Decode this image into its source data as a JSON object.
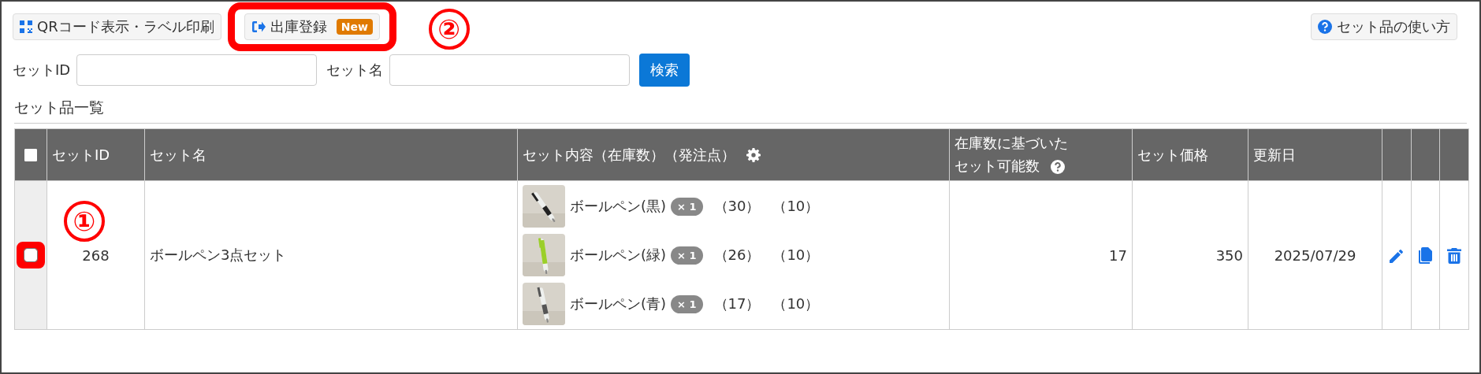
{
  "toolbar": {
    "buttons": [
      {
        "kind": "qr",
        "label": "QRコード表示・ラベル印刷",
        "highlighted": false
      },
      {
        "kind": "ship",
        "label": "出庫登録",
        "badge": "New",
        "highlighted": true,
        "callout": "②"
      }
    ],
    "help_button": {
      "label": "セット品の使い方"
    }
  },
  "search": {
    "fields": [
      {
        "label": "セットID"
      },
      {
        "label": "セット名"
      }
    ],
    "button": "検索"
  },
  "section_title": "セット品一覧",
  "table": {
    "select_all": {
      "checked": false
    },
    "columns": [
      {
        "kind": "text",
        "label": "セットID"
      },
      {
        "kind": "text",
        "label": "セット名"
      },
      {
        "kind": "settings",
        "label": "セット内容（在庫数）（発注点）"
      },
      {
        "kind": "help",
        "label_lines": [
          "在庫数に基づいた",
          "セット可能数"
        ]
      },
      {
        "kind": "text",
        "label": "セット価格"
      },
      {
        "kind": "text",
        "label": "更新日"
      }
    ],
    "rows": [
      {
        "checked": false,
        "highlighted": true,
        "callout": "①",
        "set_id": "268",
        "name": "ボールペン3点セット",
        "items": [
          {
            "name": "ボールペン(黒)",
            "quantity": "× 1",
            "stock": "（30）",
            "reorder_point": "（10）"
          },
          {
            "name": "ボールペン(緑)",
            "quantity": "× 1",
            "stock": "（26）",
            "reorder_point": "（10）"
          },
          {
            "name": "ボールペン(青)",
            "quantity": "× 1",
            "stock": "（17）",
            "reorder_point": "（10）"
          }
        ],
        "possible": "17",
        "price": "350",
        "updated": "2025/07/29",
        "actions": [
          {
            "kind": "edit"
          },
          {
            "kind": "copy"
          },
          {
            "kind": "delete"
          }
        ]
      }
    ]
  }
}
